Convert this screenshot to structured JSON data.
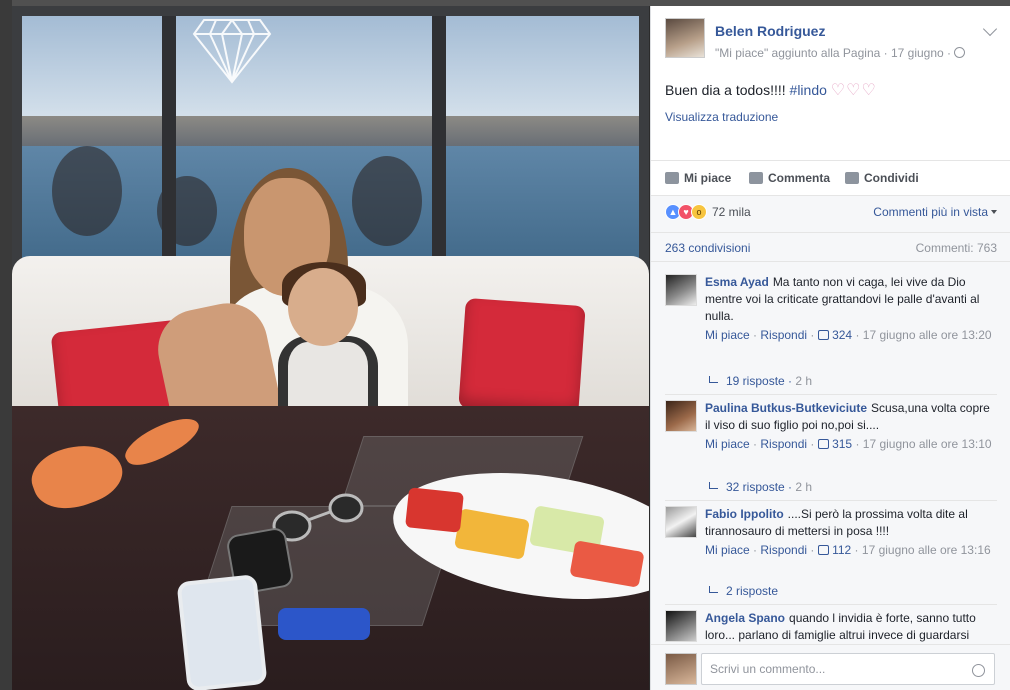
{
  "post": {
    "author": "Belen Rodriguez",
    "meta": "\"Mi piace\" aggiunto alla Pagina · 17 giugno ·",
    "text_prefix": "Buen dia a todos!!!! ",
    "hashtag": "#lindo",
    "hearts": "♡♡♡",
    "translate": "Visualizza traduzione"
  },
  "actions": {
    "like": "Mi piace",
    "comment": "Commenta",
    "share": "Condividi"
  },
  "reactions": {
    "count": "72 mila",
    "sort_label": "Commenti più in vista"
  },
  "stats": {
    "shares": "263 condivisioni",
    "comments": "Commenti: 763"
  },
  "comments": [
    {
      "name": "Esma Ayad",
      "text": "Ma tanto non vi caga, lei vive da Dio mentre voi la criticate grattandovi le palle d'avanti al nulla.",
      "like": "Mi piace",
      "reply": "Rispondi",
      "likes": "324",
      "time": "17 giugno alle ore 13:20",
      "replies": "19 risposte",
      "replies_time": "2 h"
    },
    {
      "name": "Paulina Butkus-Butkeviciute",
      "text": "Scusa,una volta copre il viso di suo figlio poi no,poi si....",
      "like": "Mi piace",
      "reply": "Rispondi",
      "likes": "315",
      "time": "17 giugno alle ore 13:10",
      "replies": "32 risposte",
      "replies_time": "2 h"
    },
    {
      "name": "Fabio Ippolito",
      "text": "....Si però la prossima volta dite al tirannosauro di mettersi in posa !!!!",
      "like": "Mi piace",
      "reply": "Rispondi",
      "likes": "112",
      "time": "17 giugno alle ore 13:16",
      "replies": "2 risposte"
    },
    {
      "name": "Angela Spano",
      "text": "quando l invidia è forte, sanno tutto loro... parlano di famiglie altrui invece di guardarsi"
    }
  ],
  "composer": {
    "placeholder": "Scrivi un commento..."
  },
  "colors": {
    "link": "#365899",
    "muted": "#90949c",
    "panel": "#f6f7f9",
    "like_reaction": "#5890ff",
    "love_reaction": "#f25268",
    "wow_reaction": "#f7c43f"
  },
  "icons": [
    "diamond-icon",
    "globe-icon",
    "chevron-down-icon",
    "like-icon",
    "comment-icon",
    "share-icon",
    "thumb-icon",
    "reply-arrow-icon",
    "smiley-icon"
  ]
}
